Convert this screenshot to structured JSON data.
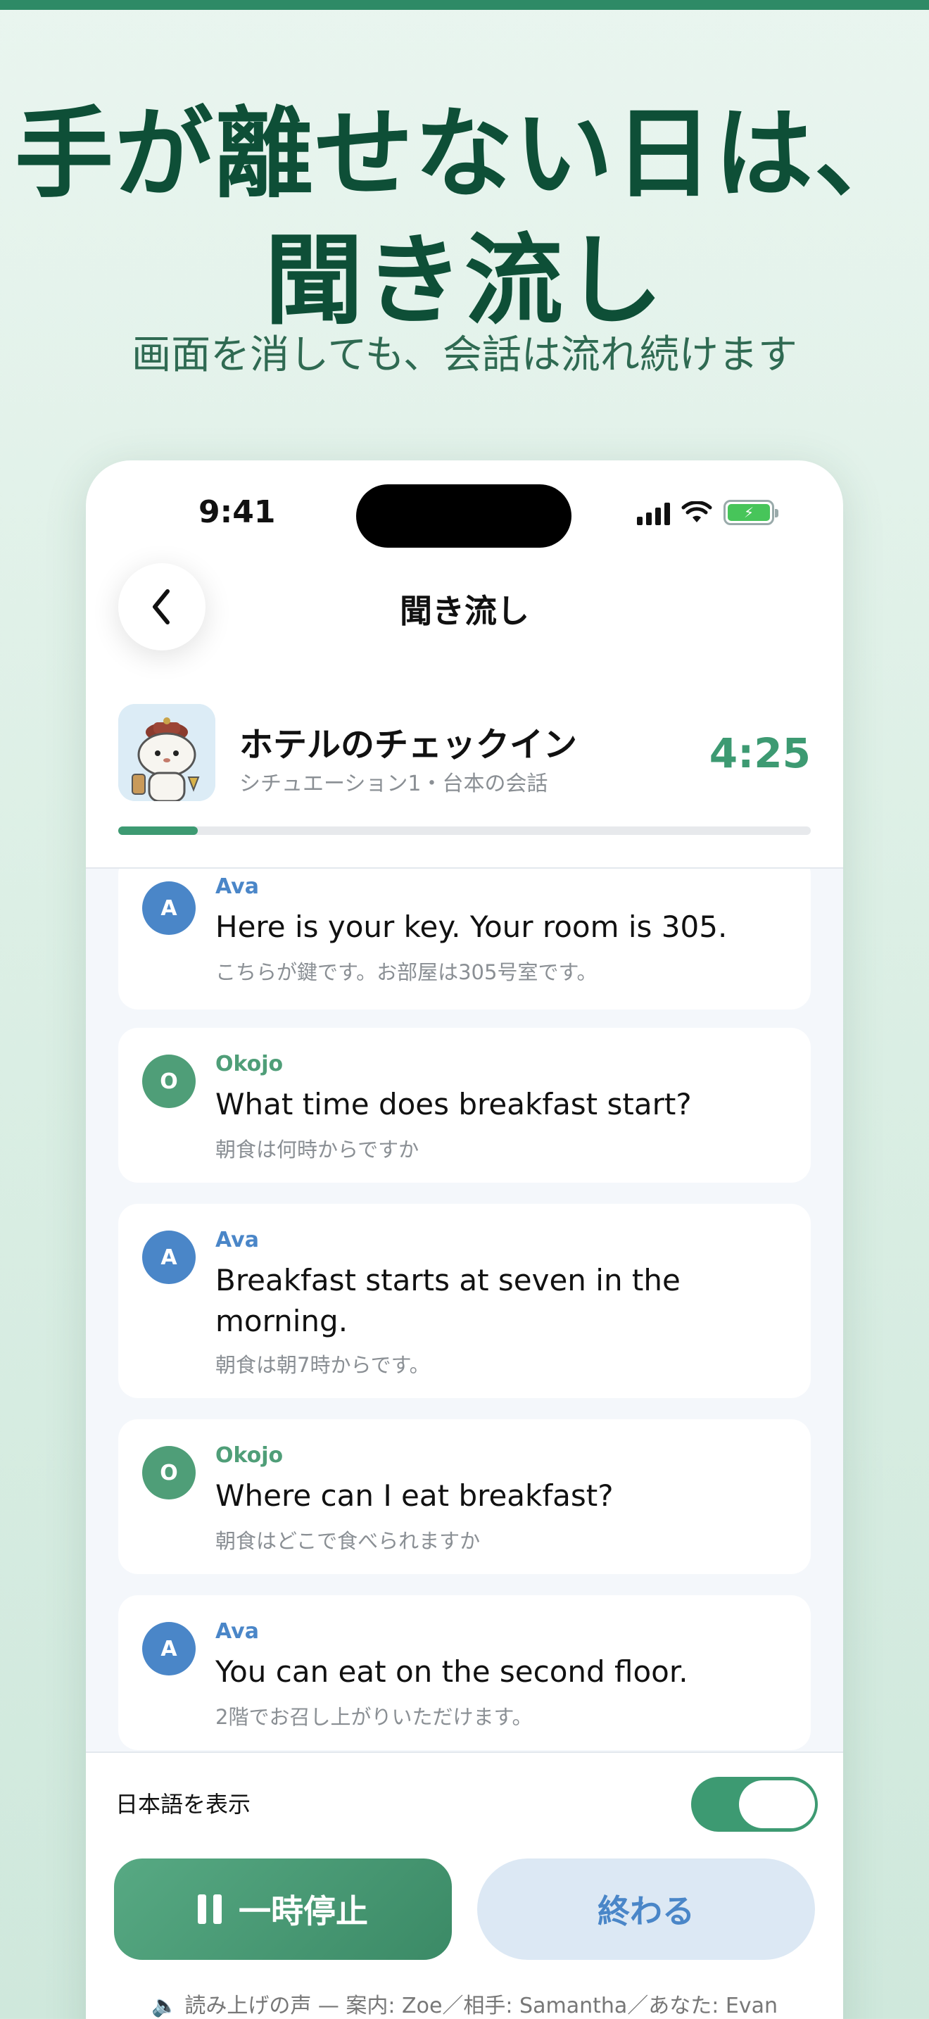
{
  "hero": {
    "title_line1": "手が離せない日は、",
    "title_line2": "聞き流し",
    "subtitle": "画面を消しても、会話は流れ続けます"
  },
  "status_bar": {
    "time": "9:41"
  },
  "nav": {
    "title": "聞き流し",
    "back_icon": "chevron-left-icon"
  },
  "scenario": {
    "title": "ホテルのチェックイン",
    "subtitle": "シチュエーション1・台本の会話",
    "time_remaining": "4:25",
    "progress_fraction": 0.115
  },
  "messages": [
    {
      "avatar": "A",
      "speaker": "Ava",
      "role": "a",
      "en": "Here is your key. Your room is 305.",
      "ja": "こちらが鍵です。お部屋は305号室です。"
    },
    {
      "avatar": "O",
      "speaker": "Okojo",
      "role": "o",
      "en": "What time does breakfast start?",
      "ja": "朝食は何時からですか"
    },
    {
      "avatar": "A",
      "speaker": "Ava",
      "role": "a",
      "en": "Breakfast starts at seven in the morning.",
      "ja": "朝食は朝7時からです。"
    },
    {
      "avatar": "O",
      "speaker": "Okojo",
      "role": "o",
      "en": "Where can I eat breakfast?",
      "ja": "朝食はどこで食べられますか"
    },
    {
      "avatar": "A",
      "speaker": "Ava",
      "role": "a",
      "en": "You can eat on the second floor.",
      "ja": "2階でお召し上がりいただけます。"
    }
  ],
  "controls": {
    "toggle_label": "日本語を表示",
    "toggle_on": true,
    "pause_label": "一時停止",
    "end_label": "終わる",
    "voice_info": "読み上げの声 — 案内: Zoe／相手: Samantha／あなた: Evan"
  },
  "colors": {
    "accent": "#3d9a72",
    "hero_text": "#0e4f37",
    "ava": "#4a86c8",
    "okojo": "#4f9e78"
  }
}
